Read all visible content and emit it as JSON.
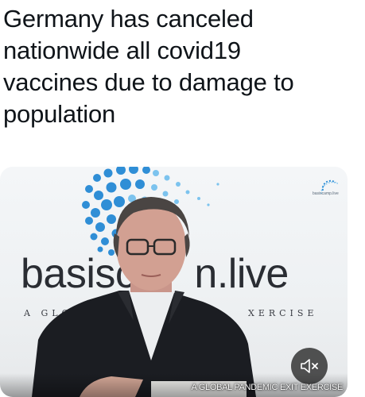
{
  "post": {
    "text_lines": [
      "Germany has canceled",
      "nationwide all covid19",
      "vaccines due to damage to",
      "population"
    ]
  },
  "video": {
    "wordmark": "basiscamp.live",
    "wordmark_visible_left": "basisc",
    "wordmark_visible_right": "n.live",
    "tagline_left": "A GLOBA",
    "tagline_right": "XERCISE",
    "corner_logo_text": "basiscamp.live",
    "caption": "A GLOBAL PANDEMIC EXIT EXERCISE",
    "mute_icon": "speaker-muted-icon",
    "colors": {
      "brand_blue": "#2f8ed6",
      "brand_light": "#7cc3ee",
      "overlay": "#141414"
    }
  }
}
